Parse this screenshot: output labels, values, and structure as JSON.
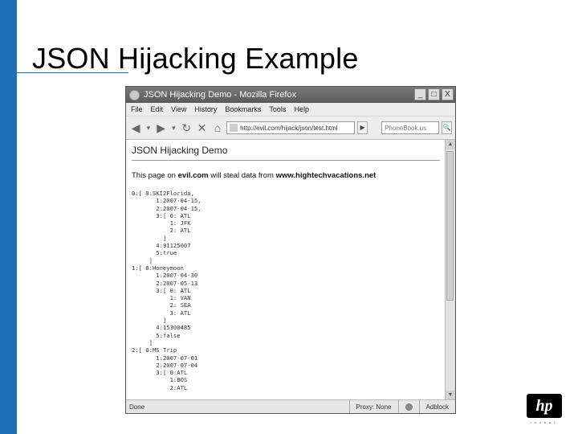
{
  "slide": {
    "title": "JSON Hijacking Example",
    "logo_text": "hp",
    "logo_tagline": "invent"
  },
  "window": {
    "title": "JSON Hijacking Demo - Mozilla Firefox",
    "controls": [
      "_",
      "□",
      "X"
    ]
  },
  "menu": {
    "items": [
      "File",
      "Edit",
      "View",
      "History",
      "Bookmarks",
      "Tools",
      "Help"
    ]
  },
  "toolbar": {
    "back": "◀",
    "forward": "▶",
    "dropdown": "▾",
    "reload": "↻",
    "stop": "✕",
    "home": "⌂",
    "url": "http://evil.com/hijack/json/test.html",
    "go": "▶",
    "search_placeholder": "PhoneBook.us",
    "search_btn": "🔍"
  },
  "page": {
    "heading": "JSON Hijacking Demo",
    "intro_prefix": "This page on ",
    "intro_site1": "evil.com",
    "intro_middle": " will steal data from ",
    "intro_site2": "www.hightechvacations.net",
    "json_dump": "0:[ 0:SKI2Florida,\n       1:2007-04-15,\n       2:2007-04-15,\n       3:[ 0: ATL\n           1: JFK\n           2: ATL\n         ]\n       4:91125007\n       5:true\n     ]\n1:[ 0:Honeymoon\n       1:2007-04-30\n       2:2007-05-13\n       3:[ 0: ATL\n           1: VAN\n           2: SEA\n           3: ATL\n         ]\n       4:15300485\n       5:false\n     ]\n2:[ 0:MS Trip\n       1:2007-07-01\n       2:2007-07-04\n       3:[ 0:ATL\n           1:BOS\n           2:ATL"
  },
  "status": {
    "left": "Done",
    "proxy": "Proxy: None",
    "addon": "Adblock"
  }
}
